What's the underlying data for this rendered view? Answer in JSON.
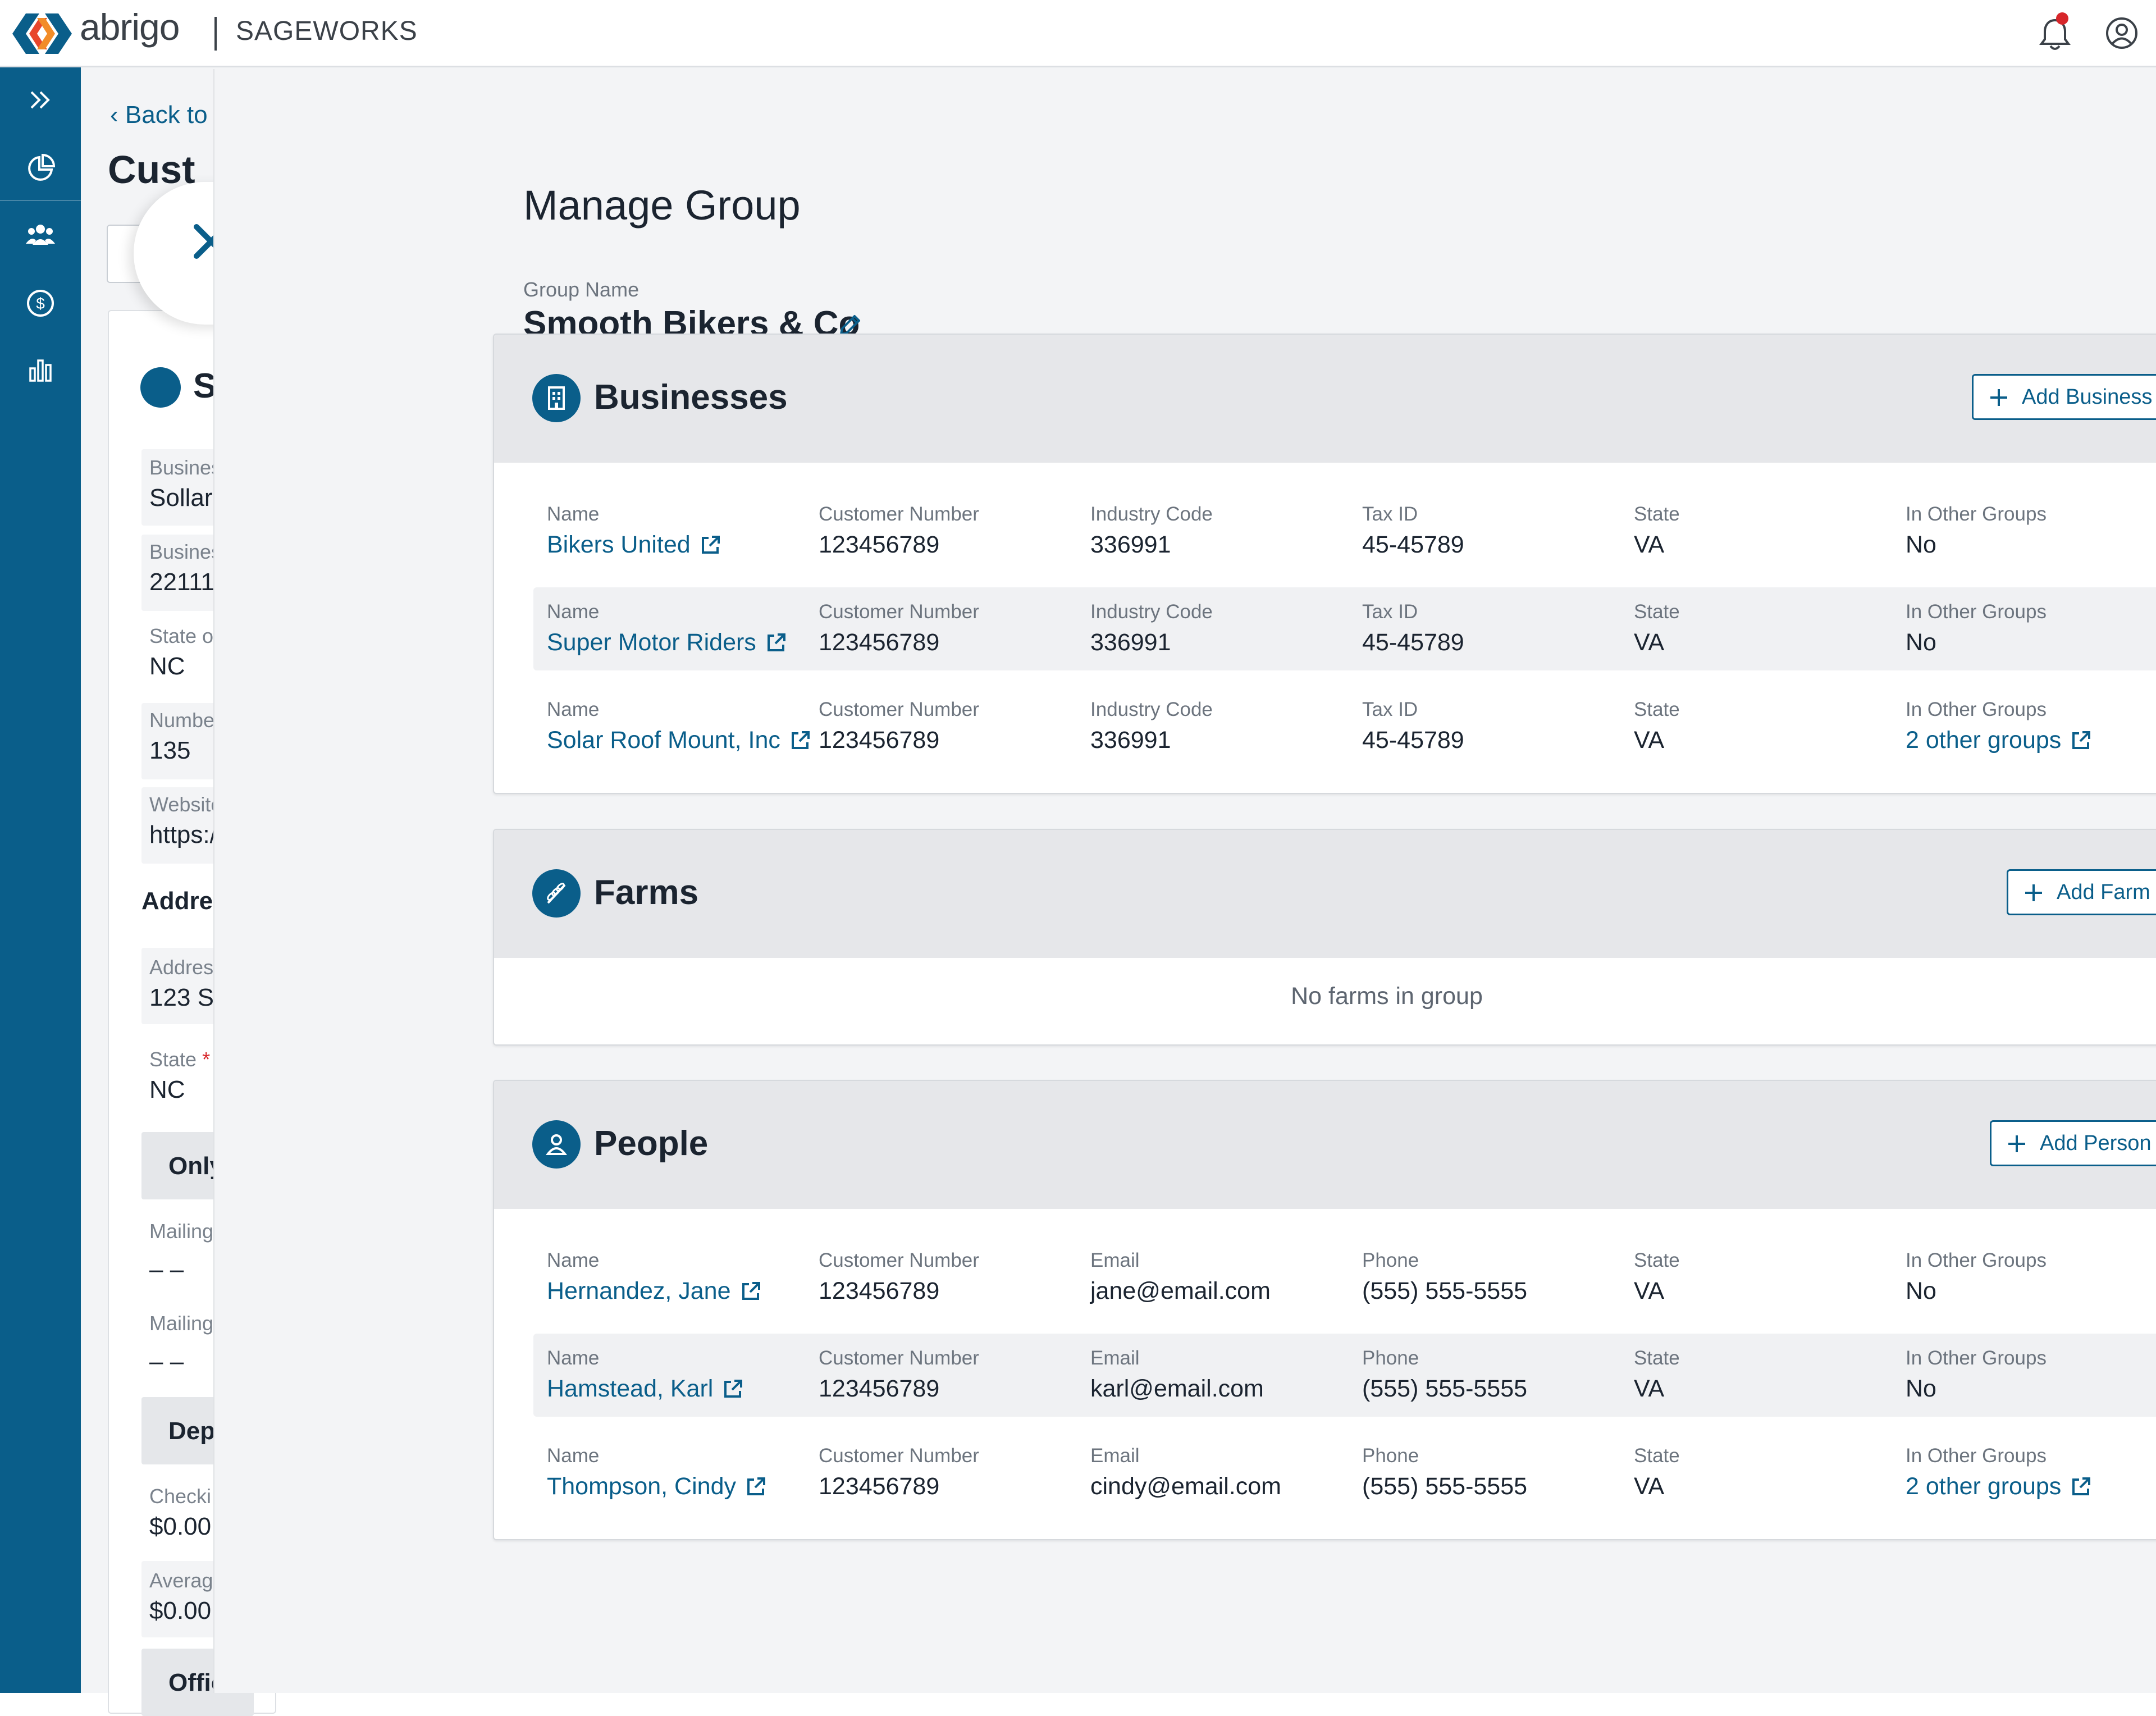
{
  "header": {
    "brand": "abrigo",
    "product": "SAGEWORKS"
  },
  "leftnav": {
    "items": [
      "expand-icon",
      "chart-pie-icon",
      "people-icon",
      "dollar-icon",
      "bar-chart-icon"
    ]
  },
  "background_page": {
    "back_link": "Back to",
    "title": "Cust",
    "card_heading": "S",
    "fields": [
      {
        "label": "Busines",
        "value": "Sollar"
      },
      {
        "label": "Busines",
        "value": "22111"
      },
      {
        "label": "State o",
        "value": "NC"
      },
      {
        "label": "Numbe",
        "value": "135"
      },
      {
        "label": "Website",
        "value": "https:/"
      }
    ],
    "address_heading": "Addres",
    "address_fields": [
      {
        "label": "Addres",
        "value": "123 S/"
      },
      {
        "label": "State",
        "required_mark": "*",
        "value": "NC"
      }
    ],
    "band_only": "Only",
    "mailing_fields": [
      {
        "label": "Mailing",
        "value": "– –"
      },
      {
        "label": "Mailing",
        "value": "– –"
      }
    ],
    "band_dep": "Depo",
    "deposit_fields": [
      {
        "label": "Checki",
        "value": "$0.00"
      },
      {
        "label": "Averag",
        "value": "$0.00"
      }
    ],
    "band_office": "Offic"
  },
  "drawer": {
    "title": "Manage Group",
    "group_name_label": "Group Name",
    "group_name": "Smooth Bikers & Co",
    "businesses": {
      "title": "Businesses",
      "add_label": "Add Business to Group",
      "columns": [
        "Name",
        "Customer Number",
        "Industry Code",
        "Tax ID",
        "State",
        "In Other Groups"
      ],
      "rows": [
        {
          "name": "Bikers United",
          "customer_number": "123456789",
          "industry_code": "336991",
          "tax_id": "45-45789",
          "state": "VA",
          "other_groups": "No",
          "other_groups_link": false
        },
        {
          "name": "Super Motor Riders",
          "customer_number": "123456789",
          "industry_code": "336991",
          "tax_id": "45-45789",
          "state": "VA",
          "other_groups": "No",
          "other_groups_link": false
        },
        {
          "name": "Solar Roof Mount, Inc",
          "customer_number": "123456789",
          "industry_code": "336991",
          "tax_id": "45-45789",
          "state": "VA",
          "other_groups": "2 other groups",
          "other_groups_link": true
        }
      ]
    },
    "farms": {
      "title": "Farms",
      "add_label": "Add Farm to Group",
      "empty_text": "No farms in group"
    },
    "people": {
      "title": "People",
      "add_label": "Add Person to Group",
      "columns": [
        "Name",
        "Customer Number",
        "Email",
        "Phone",
        "State",
        "In Other Groups"
      ],
      "rows": [
        {
          "name": "Hernandez, Jane",
          "customer_number": "123456789",
          "email": "jane@email.com",
          "phone": "(555) 555-5555",
          "state": "VA",
          "other_groups": "No",
          "other_groups_link": false
        },
        {
          "name": "Hamstead, Karl",
          "customer_number": "123456789",
          "email": "karl@email.com",
          "phone": "(555) 555-5555",
          "state": "VA",
          "other_groups": "No",
          "other_groups_link": false
        },
        {
          "name": "Thompson, Cindy",
          "customer_number": "123456789",
          "email": "cindy@email.com",
          "phone": "(555) 555-5555",
          "state": "VA",
          "other_groups": "2 other groups",
          "other_groups_link": true
        }
      ]
    }
  },
  "colors": {
    "primary": "#0a5e8a",
    "nav_bg": "#0a5e8a",
    "panel_header": "#e6e7ea",
    "alert": "#d7262a"
  }
}
